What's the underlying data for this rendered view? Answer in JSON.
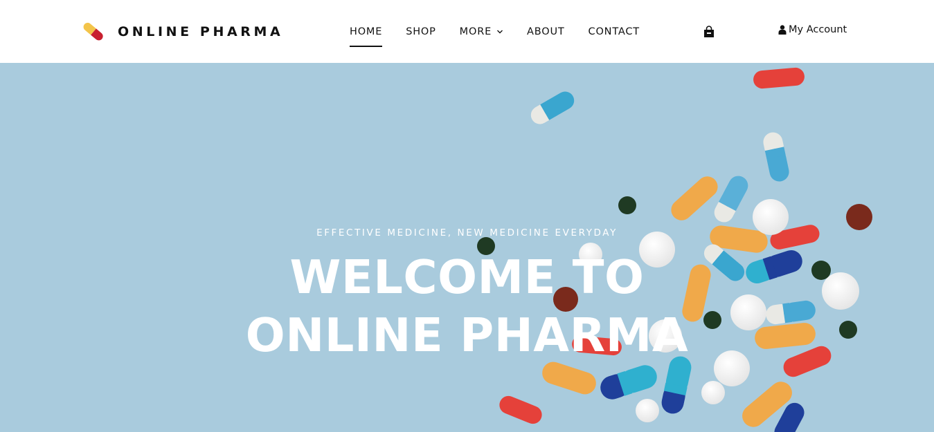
{
  "brand": {
    "name": "ONLINE PHARMA",
    "logo_icon": "capsule-logo-icon",
    "logo_colors": [
      "#f3c44a",
      "#c8202f"
    ]
  },
  "nav": {
    "items": [
      {
        "label": "HOME",
        "active": true
      },
      {
        "label": "SHOP",
        "active": false
      },
      {
        "label": "MORE",
        "active": false,
        "has_dropdown": true
      },
      {
        "label": "ABOUT",
        "active": false
      },
      {
        "label": "CONTACT",
        "active": false
      }
    ]
  },
  "header_actions": {
    "cart_icon": "shopping-bag-icon",
    "account_icon": "user-icon",
    "account_label": "My Account"
  },
  "hero": {
    "subtitle": "EFFECTIVE MEDICINE, NEW MEDICINE EVERYDAY",
    "title_line1": "WELCOME TO",
    "title_line2": "ONLINE PHARMA",
    "background_color": "#a9cbdd",
    "decoration": "scattered-pills-image"
  }
}
